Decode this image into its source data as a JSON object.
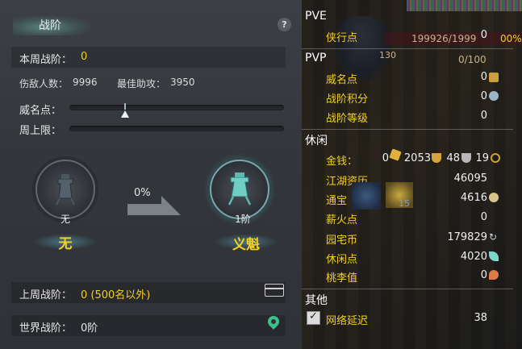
{
  "left_panel": {
    "title": "战阶",
    "help": "?",
    "weekly_rank_label": "本周战阶：",
    "weekly_rank_value": "0",
    "kills_label": "伤敌人数：",
    "kills_value": "9996",
    "assist_label": "最佳助攻：",
    "assist_value": "3950",
    "prestige_label": "威名点：",
    "prestige_level": 0.26,
    "weekly_cap_label": "周上限：",
    "weekly_cap_level": 0.0,
    "current_rank": {
      "badge_text": "无",
      "name": "无"
    },
    "progress_percent": "0%",
    "next_rank": {
      "badge_text": "1阶",
      "name": "义魁"
    },
    "last_week_label": "上周战阶：",
    "last_week_value": "0 (500名以外)",
    "world_rank_label": "世界战阶：",
    "world_rank_value": "0阶"
  },
  "right_panel": {
    "hp_text": "199926/1999",
    "hp_pct_suffix": "00%",
    "level_text": "130",
    "mp_text": "0/100",
    "pve": {
      "title": "PVE",
      "items": [
        {
          "label": "侠行点",
          "value": "0"
        }
      ]
    },
    "pvp": {
      "title": "PVP",
      "items": [
        {
          "label": "威名点",
          "value": "0"
        },
        {
          "label": "战阶积分",
          "value": "0"
        },
        {
          "label": "战阶等级",
          "value": "0"
        }
      ]
    },
    "leisure": {
      "title": "休闲",
      "money": {
        "label": "金钱：",
        "gold": "0",
        "silver": "2053",
        "copper": "48",
        "iron": "19"
      },
      "items": [
        {
          "label": "江湖资历",
          "value": "46095"
        },
        {
          "label": "通宝",
          "value": "4616"
        },
        {
          "label": "薪火点",
          "value": "0"
        },
        {
          "label": "园宅币",
          "value": "179829"
        },
        {
          "label": "休闲点",
          "value": "4020"
        },
        {
          "label": "桃李值",
          "value": "0"
        }
      ],
      "pet_count": "15"
    },
    "other": {
      "title": "其他",
      "latency_label": "网络延迟",
      "latency_value": "38"
    }
  },
  "colors": {
    "accent_yellow": "#f2d024",
    "panel_bg": "#33363b",
    "teal": "#6fcfc4"
  },
  "icons": [
    "help-icon",
    "slider-thumb-icon",
    "empty-emblem-icon",
    "ritual-vessel-icon",
    "arrow-right-icon",
    "chest-icon",
    "map-pin-icon",
    "medal-icon",
    "badge-icon",
    "gold-ingot-icon",
    "silver-ingot-icon",
    "coin-icon",
    "tongbao-coin-icon",
    "fire-icon",
    "refresh-icon",
    "leaf-icon",
    "peach-icon",
    "checkbox-icon"
  ]
}
